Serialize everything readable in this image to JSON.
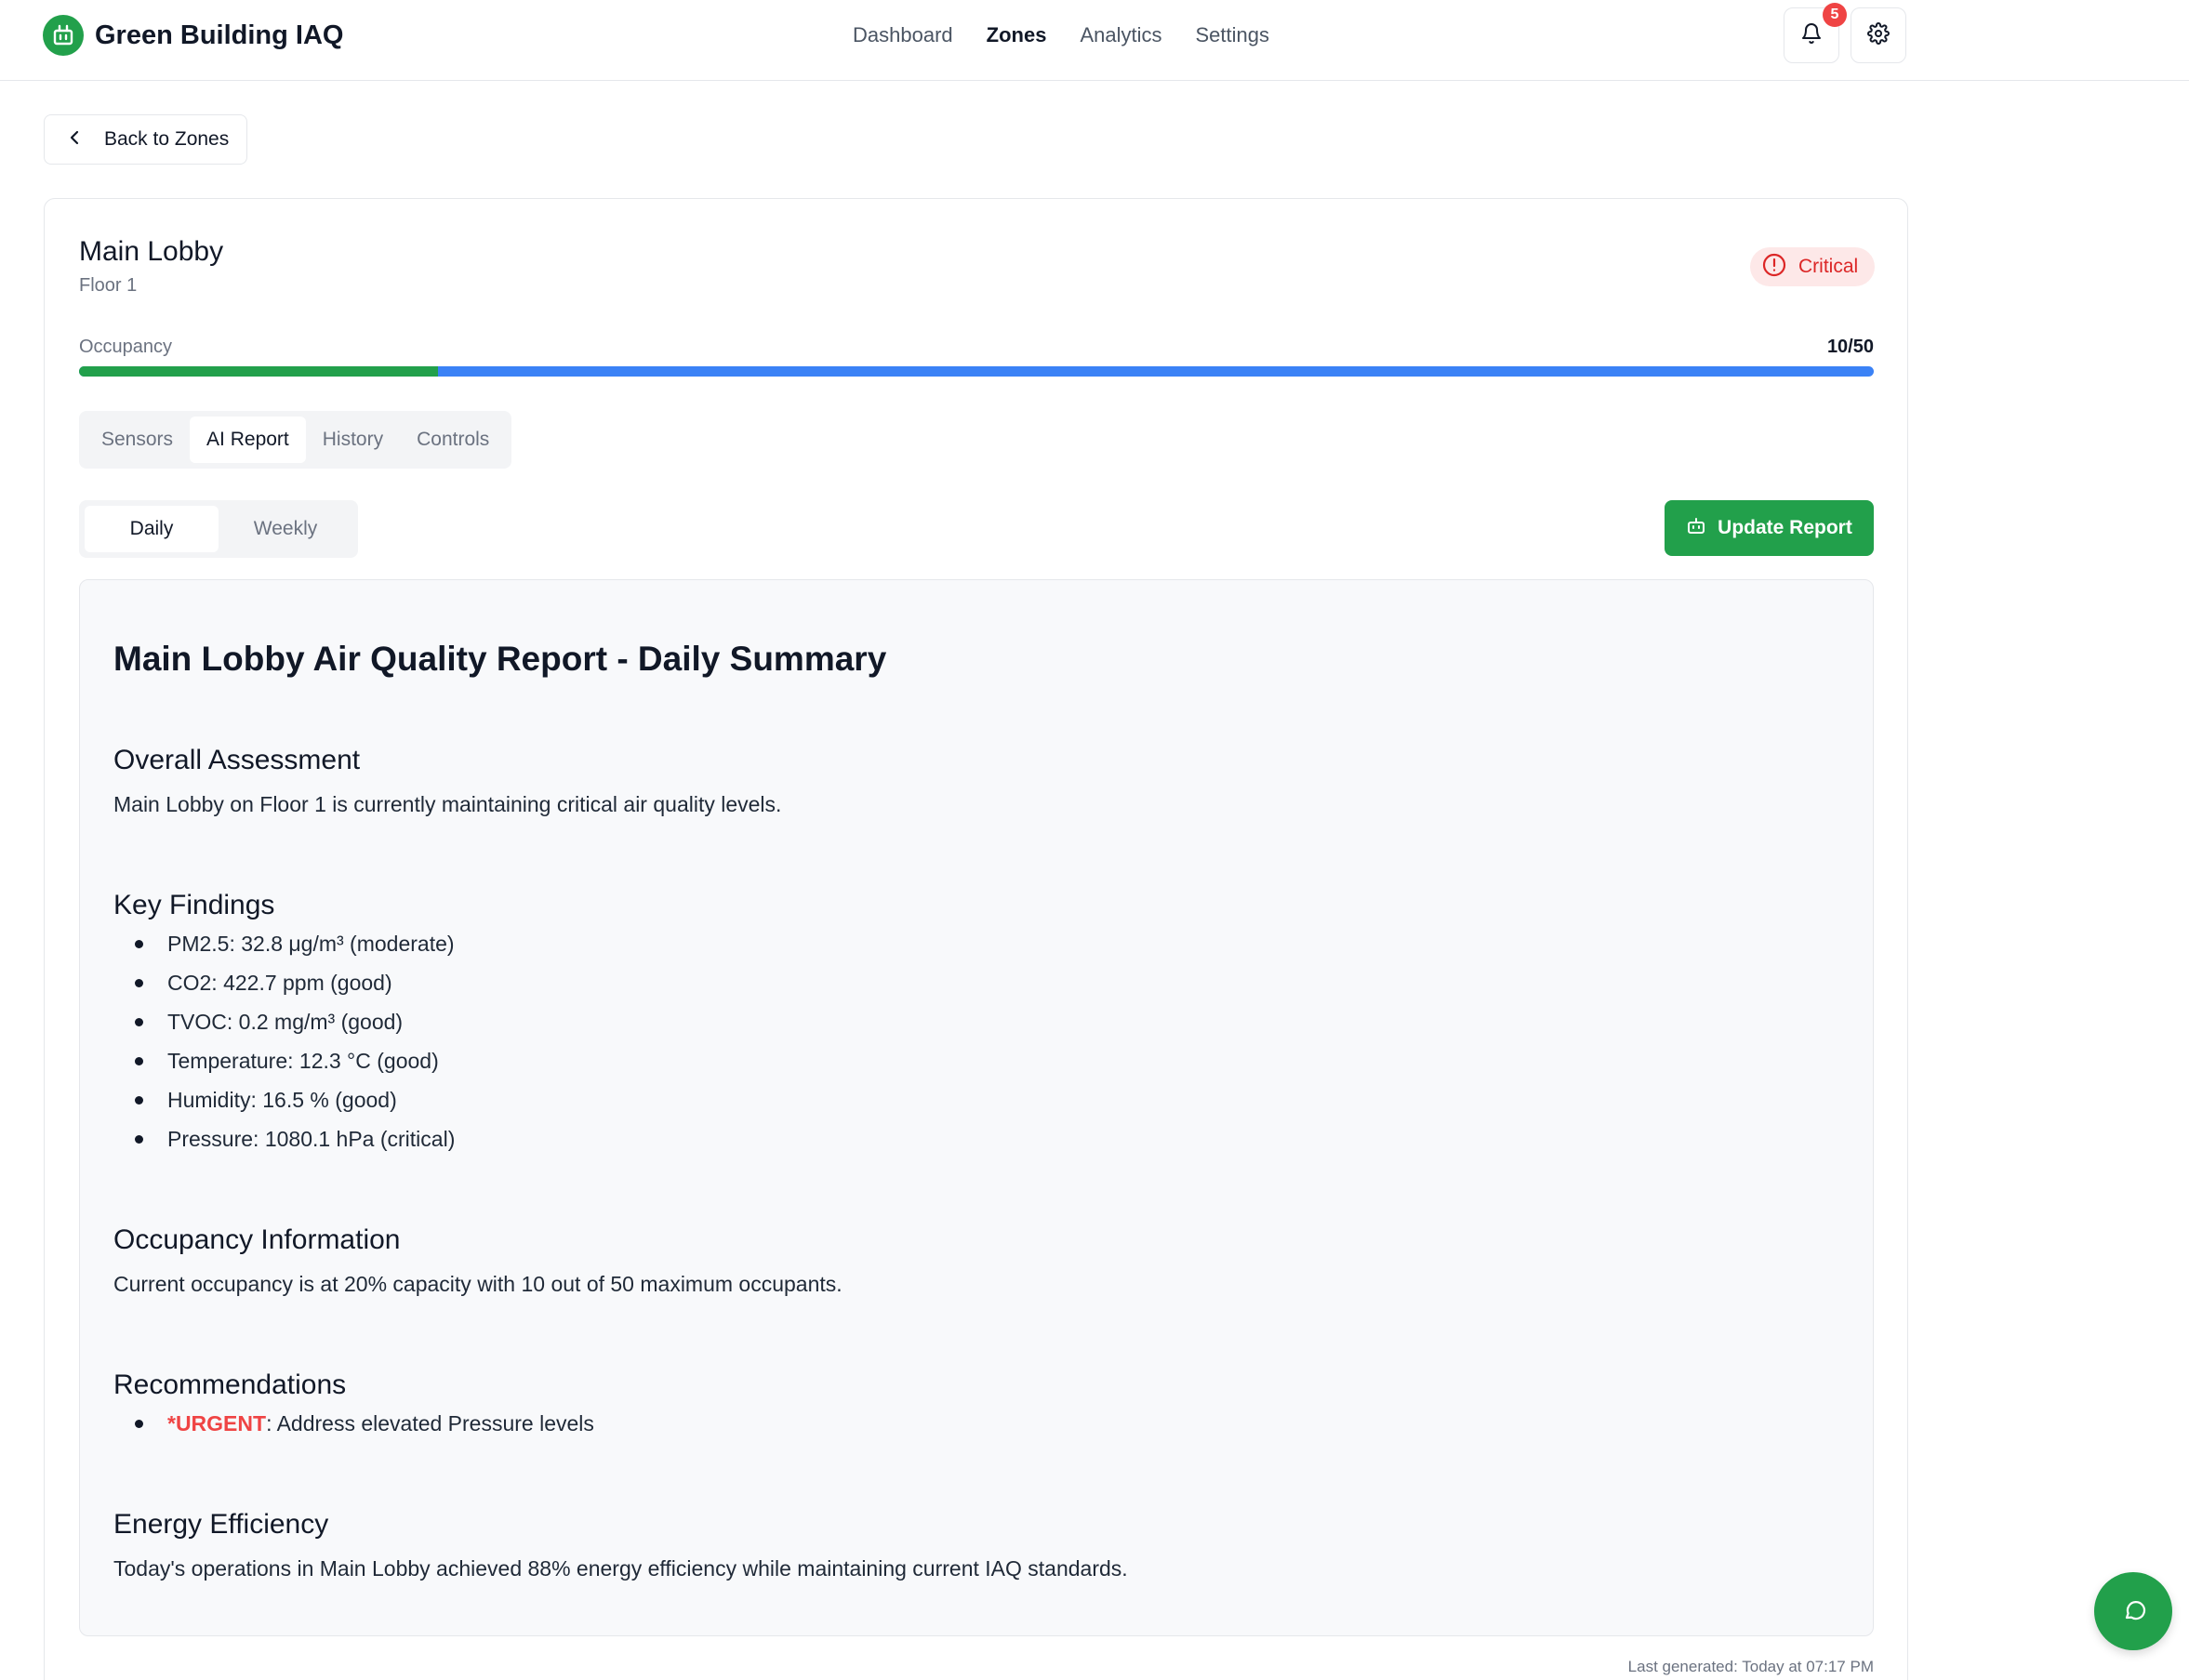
{
  "app": {
    "title": "Green Building IAQ"
  },
  "nav": {
    "items": [
      {
        "label": "Dashboard",
        "active": false
      },
      {
        "label": "Zones",
        "active": true
      },
      {
        "label": "Analytics",
        "active": false
      },
      {
        "label": "Settings",
        "active": false
      }
    ]
  },
  "notifications": {
    "count": "5"
  },
  "back": {
    "label": "Back to Zones"
  },
  "zone": {
    "name": "Main Lobby",
    "floor": "Floor 1",
    "status": "Critical",
    "occupancy_label": "Occupancy",
    "occupancy_value": "10/50",
    "occupancy_fraction": 0.2
  },
  "tabs": [
    {
      "label": "Sensors",
      "active": false
    },
    {
      "label": "AI Report",
      "active": true
    },
    {
      "label": "History",
      "active": false
    },
    {
      "label": "Controls",
      "active": false
    }
  ],
  "subtabs": [
    {
      "label": "Daily",
      "active": true
    },
    {
      "label": "Weekly",
      "active": false
    }
  ],
  "update_button": {
    "label": "Update Report"
  },
  "report": {
    "title": "Main Lobby Air Quality Report - Daily Summary",
    "overall_heading": "Overall Assessment",
    "overall_text": "Main Lobby on Floor 1 is currently maintaining critical air quality levels.",
    "findings_heading": "Key Findings",
    "findings": [
      "PM2.5: 32.8 μg/m³ (moderate)",
      "CO2: 422.7 ppm (good)",
      "TVOC: 0.2 mg/m³ (good)",
      "Temperature: 12.3 °C (good)",
      "Humidity: 16.5 % (good)",
      "Pressure: 1080.1 hPa (critical)"
    ],
    "occupancy_heading": "Occupancy Information",
    "occupancy_text": "Current occupancy is at 20% capacity with 10 out of 50 maximum occupants.",
    "recommendations_heading": "Recommendations",
    "recommendation_urgent": "*URGENT",
    "recommendation_text": ": Address elevated Pressure levels",
    "energy_heading": "Energy Efficiency",
    "energy_text": "Today's operations in Main Lobby achieved 88% energy efficiency while maintaining current IAQ standards."
  },
  "last_generated": "Last generated: Today at 07:17 PM",
  "colors": {
    "brand": "#22a04b",
    "critical": "#dc2626",
    "bar": "#3b82f6"
  }
}
